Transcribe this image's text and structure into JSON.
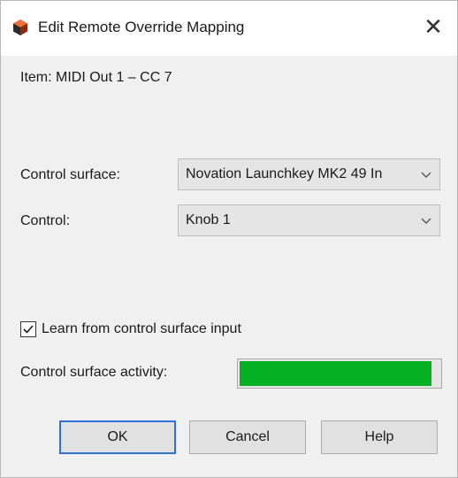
{
  "window": {
    "title": "Edit Remote Override Mapping",
    "close_glyph": "✕",
    "app_icon": "reason-app-icon"
  },
  "item": {
    "text": "Item: MIDI Out 1 – CC 7"
  },
  "control_surface": {
    "label": "Control surface:",
    "value": "Novation Launchkey MK2 49 In"
  },
  "control": {
    "label": "Control:",
    "value": "Knob 1"
  },
  "learn": {
    "label": "Learn from control surface input",
    "checked": true
  },
  "activity": {
    "label": "Control surface activity:",
    "level": 0.96,
    "color": "#06b025"
  },
  "buttons": {
    "ok": "OK",
    "cancel": "Cancel",
    "help": "Help"
  }
}
